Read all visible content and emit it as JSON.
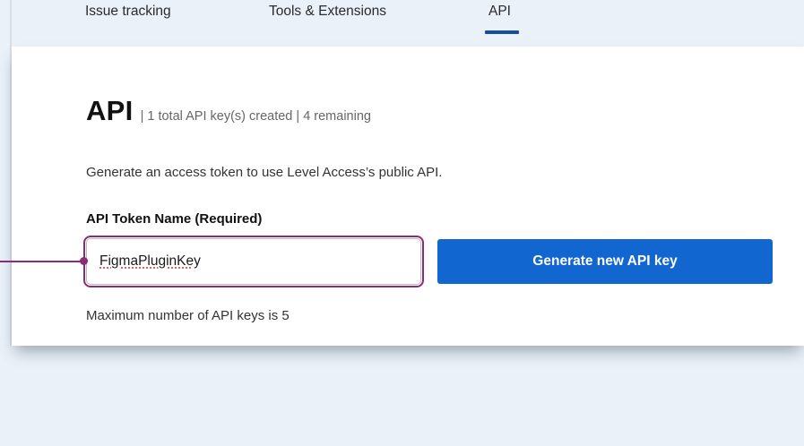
{
  "tabs": [
    {
      "label": "Issue tracking"
    },
    {
      "label": "Tools & Extensions"
    },
    {
      "label": "API",
      "active": true
    }
  ],
  "page": {
    "title": "API",
    "meta": "| 1 total API key(s) created | 4 remaining",
    "description": "Generate an access token to use Level Access’s public API."
  },
  "form": {
    "token_label": "API Token Name (Required)",
    "token_value": "FigmaPluginKey",
    "generate_button": "Generate new API key",
    "max_note": "Maximum number of API keys is 5"
  },
  "colors": {
    "accent": "#1166cf",
    "highlight": "#8b2a75",
    "tab_indicator": "#1a4f96",
    "background": "#eaf1f9"
  }
}
